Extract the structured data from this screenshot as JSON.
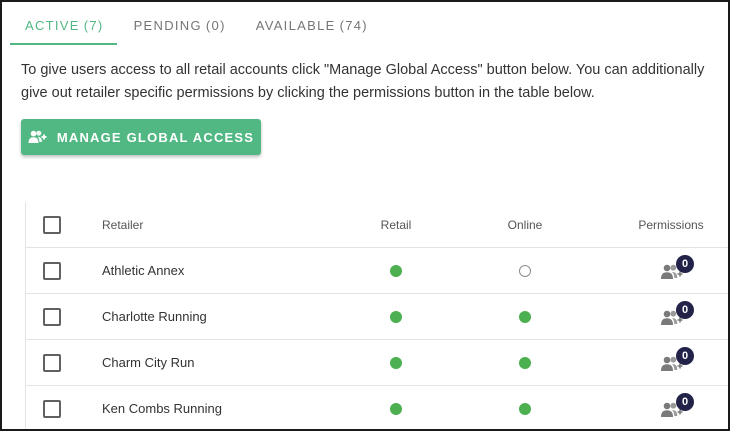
{
  "tabs": [
    {
      "label": "ACTIVE",
      "count": "(7)",
      "active": true
    },
    {
      "label": "PENDING",
      "count": "(0)",
      "active": false
    },
    {
      "label": "AVAILABLE",
      "count": "(74)",
      "active": false
    }
  ],
  "intro_text": "To give users access to all retail accounts click \"Manage Global Access\" button below. You can additionally give out retailer specific permissions by clicking the permissions button in the table below.",
  "manage_button": {
    "label": "MANAGE GLOBAL ACCESS",
    "icon": "add-users-icon"
  },
  "colors": {
    "accent": "#52b883",
    "status_on": "#4caf50",
    "badge": "#23234a"
  },
  "table": {
    "headers": {
      "retailer": "Retailer",
      "retail": "Retail",
      "online": "Online",
      "permissions": "Permissions"
    },
    "rows": [
      {
        "retailer": "Athletic Annex",
        "retail": true,
        "online": false,
        "permissions": "0"
      },
      {
        "retailer": "Charlotte Running",
        "retail": true,
        "online": true,
        "permissions": "0"
      },
      {
        "retailer": "Charm City Run",
        "retail": true,
        "online": true,
        "permissions": "0"
      },
      {
        "retailer": "Ken Combs Running",
        "retail": true,
        "online": true,
        "permissions": "0"
      }
    ]
  }
}
